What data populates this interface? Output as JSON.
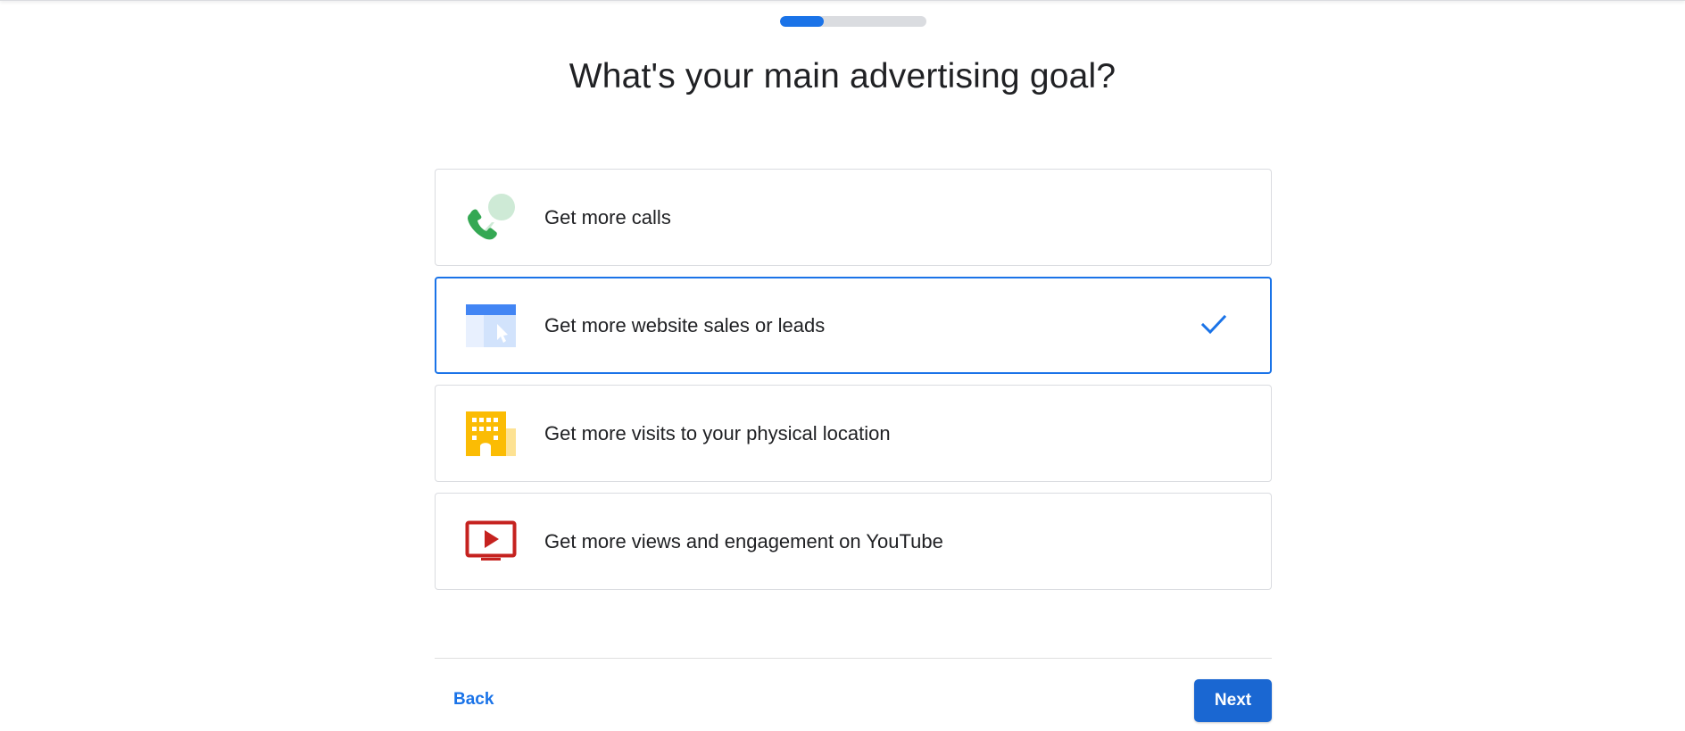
{
  "progress": {
    "fraction": 0.3
  },
  "title": "What's your main advertising goal?",
  "options": [
    {
      "label": "Get more calls",
      "icon": "phone-call-icon",
      "selected": false
    },
    {
      "label": "Get more website sales or leads",
      "icon": "website-cursor-icon",
      "selected": true
    },
    {
      "label": "Get more visits to your physical location",
      "icon": "building-icon",
      "selected": false
    },
    {
      "label": "Get more views and engagement on YouTube",
      "icon": "youtube-play-icon",
      "selected": false
    }
  ],
  "footer": {
    "back_label": "Back",
    "next_label": "Next"
  },
  "colors": {
    "accent": "#1a73e8",
    "next_button": "#1a67d2",
    "phone_green": "#34a853",
    "bubble_green": "#ceead6",
    "building_yellow": "#fbbc04",
    "youtube_red": "#c5221f"
  }
}
